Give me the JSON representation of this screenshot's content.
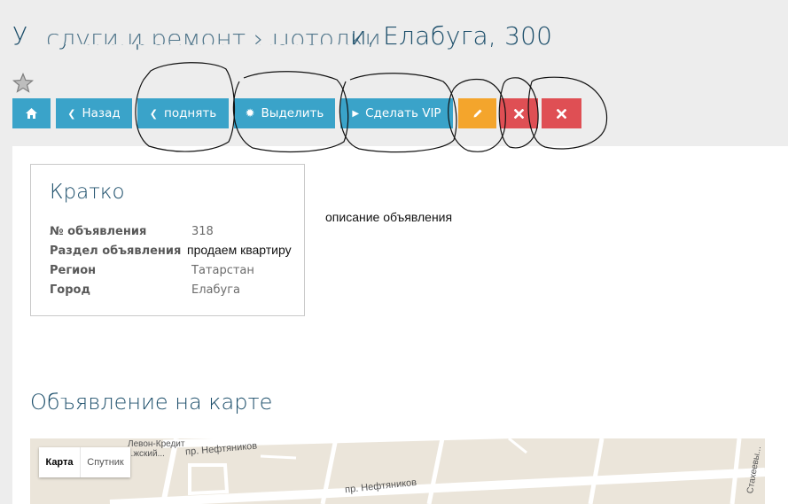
{
  "header": {
    "title": "Услуги и ремонт › Потолки, Елабуга, 300",
    "title_visible_end": "Елабуга, 300"
  },
  "toolbar": {
    "home_icon": "home-icon",
    "back_label": "Назад",
    "raise_label": "поднять",
    "highlight_label": "Выделить",
    "vip_label": "Сделать VIP",
    "edit_icon": "pencil-icon",
    "delete_icon": "close-icon",
    "remove_icon": "close-icon"
  },
  "summary": {
    "title": "Кратко",
    "rows": [
      {
        "label": "№ объявления",
        "value": "318"
      },
      {
        "label": "Раздел объявления",
        "value": "продаем квартиру"
      },
      {
        "label": "Регион",
        "value": "Татарстан"
      },
      {
        "label": "Город",
        "value": "Елабуга"
      }
    ]
  },
  "description": "описание объявления",
  "map_section": {
    "title": "Объявление на карте",
    "toggle_map": "Карта",
    "toggle_satellite": "Спутник",
    "labels": [
      "Левон-Кредит",
      "...жский...",
      "пр. Нефтяников",
      "пр. Нефтяников",
      "Стахеевы..."
    ]
  },
  "colors": {
    "blue": "#3aa3c9",
    "orange": "#f4a52c",
    "red": "#df4f54",
    "title": "#1d4f6b"
  }
}
